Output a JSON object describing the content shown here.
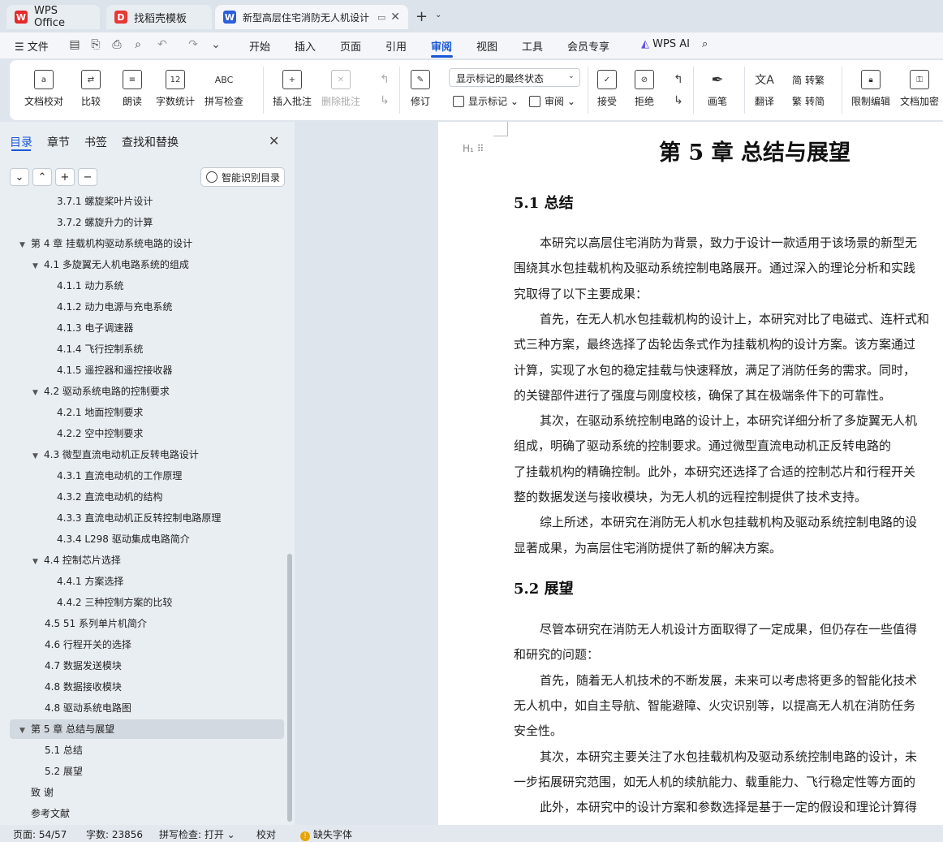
{
  "tabs": [
    {
      "label": "WPS Office",
      "icon": "wps-logo-icon",
      "color": "#e52a2a"
    },
    {
      "label": "找稻壳模板",
      "icon": "docer-icon",
      "color": "#e53935"
    },
    {
      "label": "新型高层住宅消防无人机设计",
      "icon": "word-doc-icon",
      "color": "#2b5fd9"
    }
  ],
  "menu": {
    "file": "文件",
    "items": [
      "开始",
      "插入",
      "页面",
      "引用",
      "审阅",
      "视图",
      "工具",
      "会员专享"
    ],
    "active": "审阅",
    "wps_ai": "WPS AI"
  },
  "ribbon": {
    "proofread": "文档校对",
    "compare": "比较",
    "read_aloud": "朗读",
    "word_count": "字数统计",
    "spell_check": "拼写检查",
    "insert_comment": "插入批注",
    "delete_comment": "删除批注",
    "revise": "修订",
    "markup_select": "显示标记的最终状态",
    "show_markup": "显示标记",
    "review": "审阅",
    "accept": "接受",
    "reject": "拒绝",
    "pen": "画笔",
    "translate": "翻译",
    "to_traditional": "转繁",
    "to_simplified": "转简",
    "restrict_edit": "限制编辑",
    "encrypt": "文档加密"
  },
  "nav": {
    "tabs": [
      "目录",
      "章节",
      "书签",
      "查找和替换"
    ],
    "smart_toc": "智能识别目录",
    "toc": [
      {
        "text": "3.7.1 螺旋桨叶片设计",
        "level": 3
      },
      {
        "text": "3.7.2 螺旋升力的计算",
        "level": 3
      },
      {
        "text": "第 4 章  挂载机构驱动系统电路的设计",
        "level": 1,
        "expanded": true
      },
      {
        "text": "4.1  多旋翼无人机电路系统的组成",
        "level": 2,
        "expanded": true
      },
      {
        "text": "4.1.1  动力系统",
        "level": 3
      },
      {
        "text": "4.1.2  动力电源与充电系统",
        "level": 3
      },
      {
        "text": "4.1.3  电子调速器",
        "level": 3
      },
      {
        "text": "4.1.4  飞行控制系统",
        "level": 3
      },
      {
        "text": "4.1.5  遥控器和遥控接收器",
        "level": 3
      },
      {
        "text": "4.2  驱动系统电路的控制要求",
        "level": 2,
        "expanded": true
      },
      {
        "text": "4.2.1  地面控制要求",
        "level": 3
      },
      {
        "text": "4.2.2  空中控制要求",
        "level": 3
      },
      {
        "text": "4.3  微型直流电动机正反转电路设计",
        "level": 2,
        "expanded": true
      },
      {
        "text": "4.3.1  直流电动机的工作原理",
        "level": 3
      },
      {
        "text": "4.3.2  直流电动机的结构",
        "level": 3
      },
      {
        "text": "4.3.3  直流电动机正反转控制电路原理",
        "level": 3
      },
      {
        "text": "4.3.4    L298 驱动集成电路简介",
        "level": 3
      },
      {
        "text": "4.4  控制芯片选择",
        "level": 2,
        "expanded": true
      },
      {
        "text": "4.4.1  方案选择",
        "level": 3
      },
      {
        "text": "4.4.2  三种控制方案的比较",
        "level": 3
      },
      {
        "text": "4.5 51 系列单片机简介",
        "level": 2
      },
      {
        "text": "4.6  行程开关的选择",
        "level": 2
      },
      {
        "text": "4.7 数据发送模块",
        "level": 2
      },
      {
        "text": "4.8  数据接收模块",
        "level": 2
      },
      {
        "text": "4.8  驱动系统电路图",
        "level": 2
      },
      {
        "text": "第 5 章  总结与展望",
        "level": 1,
        "expanded": true,
        "selected": true
      },
      {
        "text": "5.1  总结",
        "level": 2
      },
      {
        "text": "5.2  展望",
        "level": 2
      },
      {
        "text": "致      谢",
        "level": 0
      },
      {
        "text": "参考文献",
        "level": 0
      }
    ]
  },
  "doc": {
    "chapter_title": "第 5 章  总结与展望",
    "heading_marker": "H",
    "section1": "5.1  总结",
    "section1_lines": [
      "本研究以高层住宅消防为背景，致力于设计一款适用于该场景的新型无",
      "围绕其水包挂载机构及驱动系统控制电路展开。通过深入的理论分析和实践",
      "究取得了以下主要成果：",
      "首先，在无人机水包挂载机构的设计上，本研究对比了电磁式、连杆式和",
      "式三种方案，最终选择了齿轮齿条式作为挂载机构的设计方案。该方案通过",
      "计算，实现了水包的稳定挂载与快速释放，满足了消防任务的需求。同时，",
      "的关键部件进行了强度与刚度校核，确保了其在极端条件下的可靠性。",
      "其次，在驱动系统控制电路的设计上，本研究详细分析了多旋翼无人机",
      "组成，明确了驱动系统的控制要求。通过微型直流电动机正反转电路的",
      "了挂载机构的精确控制。此外，本研究还选择了合适的控制芯片和行程开关",
      "整的数据发送与接收模块，为无人机的远程控制提供了技术支持。",
      "综上所述，本研究在消防无人机水包挂载机构及驱动系统控制电路的设",
      "显著成果，为高层住宅消防提供了新的解决方案。"
    ],
    "section2": "5.2  展望",
    "section2_lines": [
      "尽管本研究在消防无人机设计方面取得了一定成果，但仍存在一些值得",
      "和研究的问题：",
      "首先，随着无人机技术的不断发展，未来可以考虑将更多的智能化技术",
      "无人机中，如自主导航、智能避障、火灾识别等，以提高无人机在消防任务",
      "安全性。",
      "其次，本研究主要关注了水包挂载机构及驱动系统控制电路的设计，未",
      "一步拓展研究范围，如无人机的续航能力、载重能力、飞行稳定性等方面的",
      "此外，本研究中的设计方案和参数选择是基于一定的假设和理论计算得"
    ]
  },
  "status": {
    "page": "页面: 54/57",
    "words": "字数: 23856",
    "spell": "拼写检查: 打开",
    "proof": "校对",
    "missing_font": "缺失字体"
  },
  "colors": {
    "accent": "#1a57d4",
    "wps_red": "#e52a2a"
  }
}
